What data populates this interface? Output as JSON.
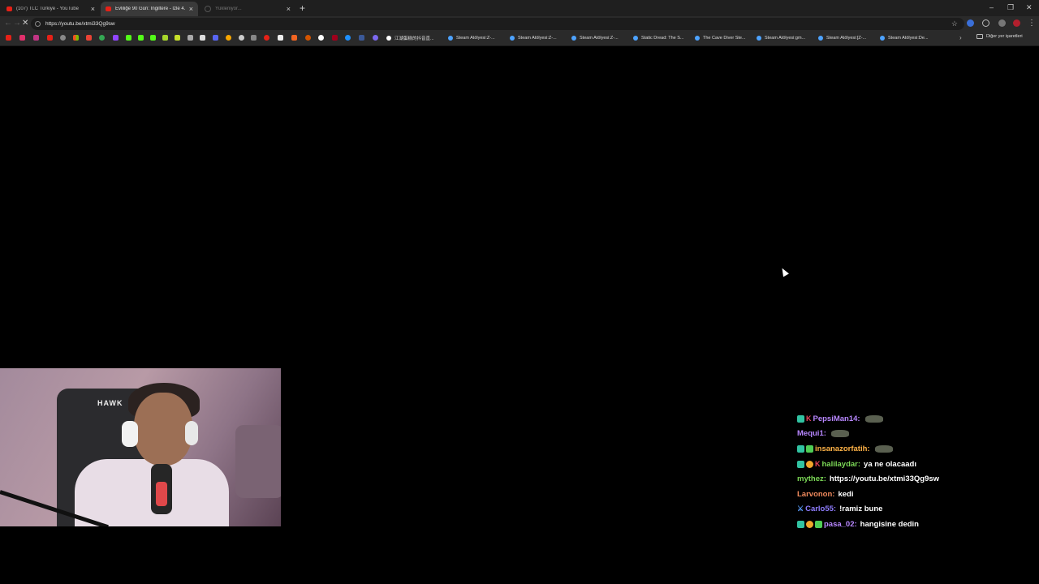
{
  "browser": {
    "tabs": [
      {
        "title": "(107) TLC Türkiye - YouTube",
        "active": false
      },
      {
        "title": "Evliliğe 90 Gün: İngiltere - İzle 4. S",
        "active": true
      },
      {
        "title": "Yükleniyor...",
        "active": false
      }
    ],
    "url": "https://youtu.be/xtmi33Qg9sw",
    "bookmarks": [
      "江湖蛋糕的抖音直...",
      "Steam Atölyesi:Z-...",
      "Steam Atölyesi:Z-...",
      "Steam Atölyesi:Z-...",
      "Static Dread: The S...",
      "The Cave Diver Ste...",
      "Steam Atölyesi:gm...",
      "Steam Atölyesi:[Z-...",
      "Steam Atölyesi:De..."
    ],
    "other_bookmarks": "Diğer yer işaretleri",
    "colors": {
      "tabstrip": "#1f1f1f",
      "toolbar": "#2a2a2a",
      "active_tab": "#3a3a3a",
      "youtube_red": "#e62117"
    }
  },
  "stream": {
    "webcam_chair_brand": "HAWK"
  },
  "chat": [
    {
      "badges": [
        "tv",
        "k"
      ],
      "user": "PepsiMan14:",
      "user_color": "#b887ff",
      "text": "",
      "emote": true
    },
    {
      "badges": [],
      "user": "Mequi1:",
      "user_color": "#b887ff",
      "text": "",
      "emote": true
    },
    {
      "badges": [
        "tv",
        "k2"
      ],
      "user": "insanazorfatih:",
      "user_color": "#ffb347",
      "text": "",
      "emote": true
    },
    {
      "badges": [
        "tv",
        "one",
        "k"
      ],
      "user": "halilaydar:",
      "user_color": "#7cd957",
      "text": "ya ne olacaadı",
      "emote": false
    },
    {
      "badges": [],
      "user": "mythez:",
      "user_color": "#7cd957",
      "text": "https://youtu.be/xtmi33Qg9sw",
      "emote": false
    },
    {
      "badges": [],
      "user": "Larvonon:",
      "user_color": "#f08a5d",
      "text": "kedi",
      "emote": false
    },
    {
      "badges": [
        "sword"
      ],
      "user": "Carlo55:",
      "user_color": "#8f7dff",
      "text": "!ramiz bune",
      "emote": false
    },
    {
      "badges": [
        "tv",
        "one",
        "k2"
      ],
      "user": "pasa_02:",
      "user_color": "#b887ff",
      "text": "hangisine dedin",
      "emote": false
    }
  ]
}
